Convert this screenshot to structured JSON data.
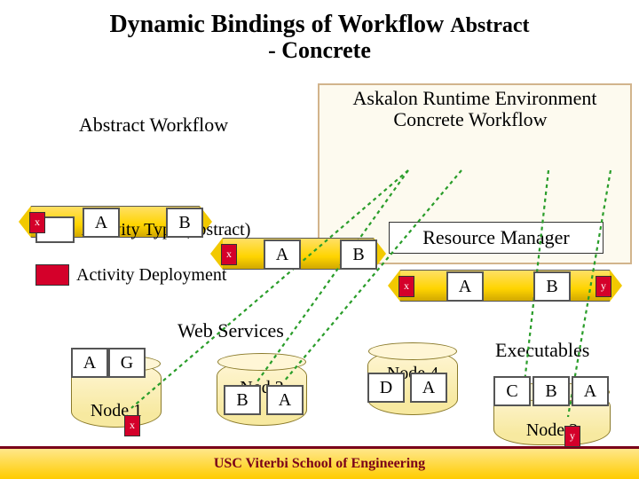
{
  "title": "Dynamic Bindings of Workflow",
  "subtitle_part1": "Abstract",
  "subtitle": "- Concrete",
  "runtime_label": "Askalon Runtime Environment",
  "abstract_label": "Abstract Workflow",
  "concrete_label": "Concrete Workflow",
  "pipe1": {
    "slot_left": "x",
    "A": "A",
    "B": "B"
  },
  "pipe2": {
    "slot_left": "x",
    "A": "A",
    "B": "B"
  },
  "pipe3": {
    "slot_left": "x",
    "A": "A",
    "B": "B",
    "slot_right": "y"
  },
  "legend1": "Activity Type (abstract)",
  "legend2": "Activity Deployment",
  "resource_manager": "Resource Manager",
  "web_services_label": "Web Services",
  "executables_label": "Executables",
  "node1": {
    "label": "Node 1",
    "A": "A",
    "G": "G",
    "slot": "x"
  },
  "node2": {
    "label": "Nod 2",
    "B": "B",
    "A": "A"
  },
  "node3": {
    "label": "Node 3",
    "C": "C",
    "B": "B",
    "A": "A",
    "slot": "y"
  },
  "node4": {
    "label": "Node 4",
    "D": "D",
    "A": "A"
  },
  "footer": "USC Viterbi School of Engineering"
}
